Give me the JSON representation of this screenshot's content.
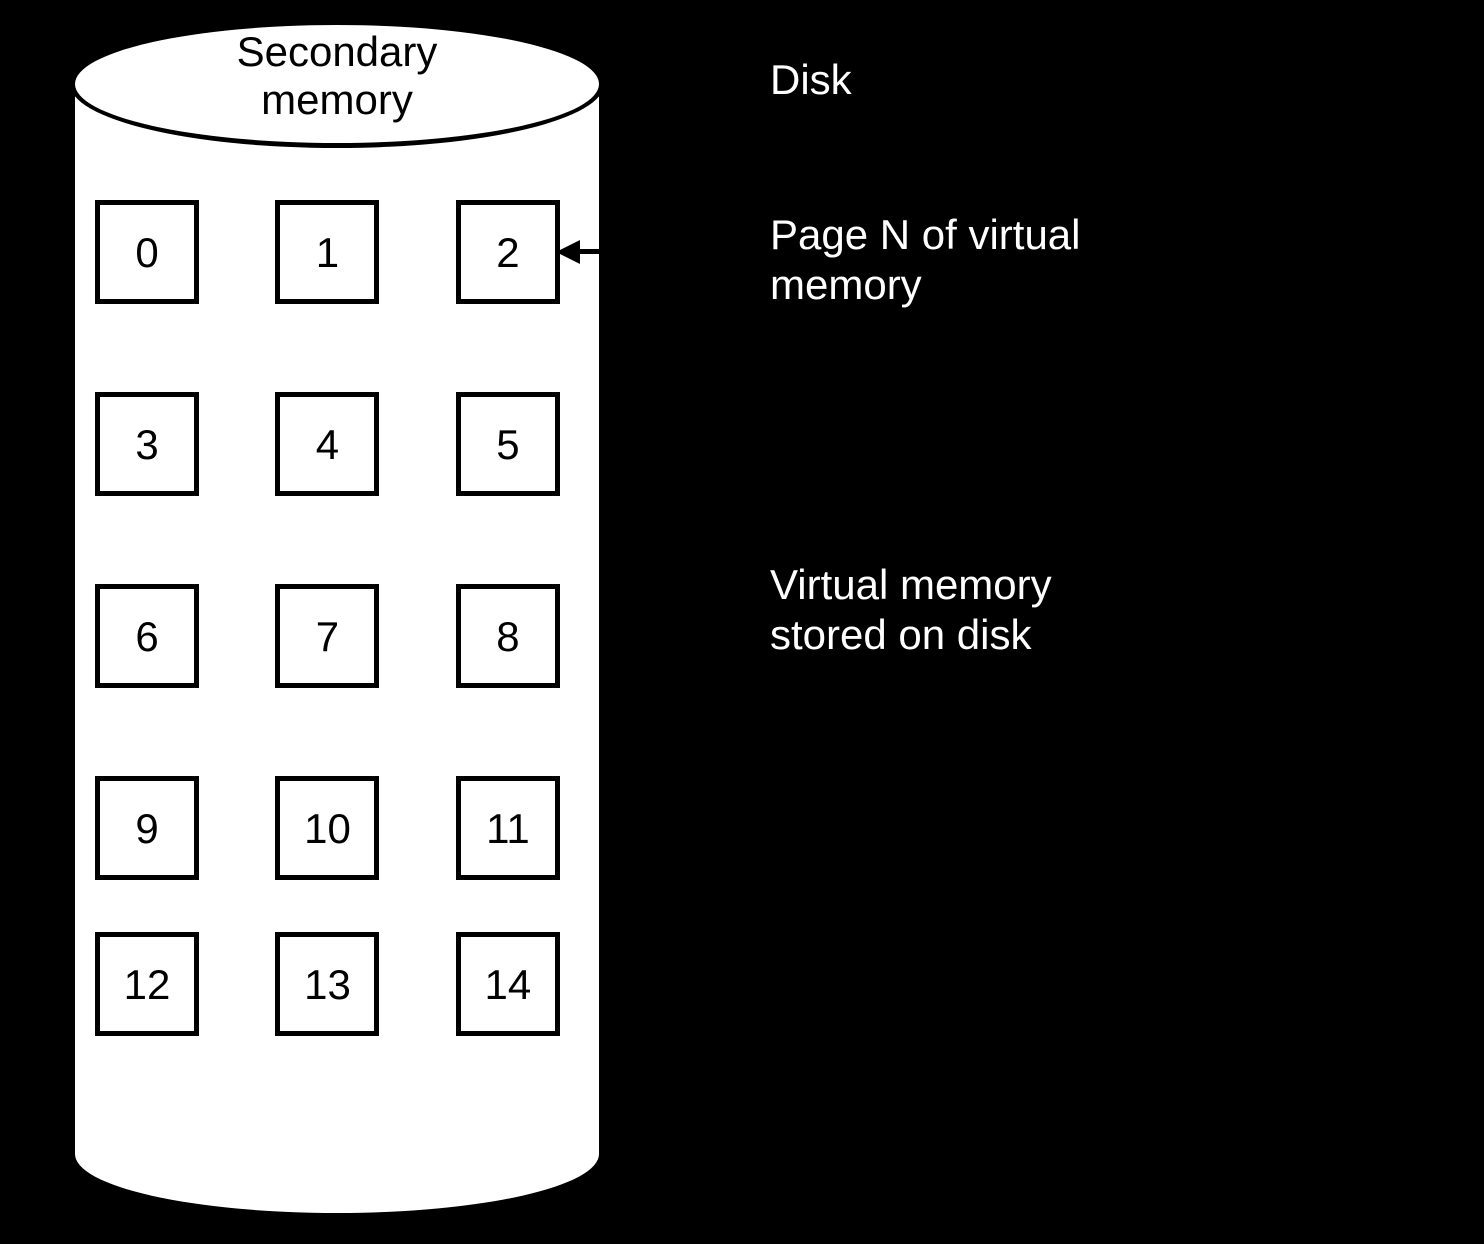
{
  "title_line1": "Secondary",
  "title_line2": "memory",
  "pages": [
    "0",
    "1",
    "2",
    "3",
    "4",
    "5",
    "6",
    "7",
    "8",
    "9",
    "10",
    "11",
    "12",
    "13",
    "14"
  ],
  "annot_disk": "Disk",
  "annot_stored_l1": "Virtual memory",
  "annot_stored_l2": "stored on disk",
  "annot_main_l1": "Page N of virtual",
  "annot_main_l2": "memory"
}
